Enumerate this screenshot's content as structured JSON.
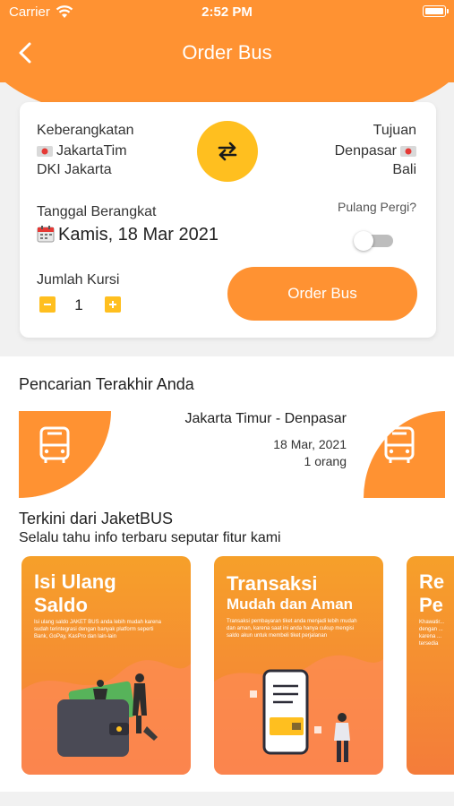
{
  "status_bar": {
    "carrier": "Carrier",
    "time": "2:52 PM"
  },
  "header": {
    "title": "Order Bus",
    "back_icon": "chevron-left-icon"
  },
  "booking": {
    "departure_label": "Keberangkatan",
    "departure_city": "JakartaTim",
    "departure_province": "DKI Jakarta",
    "destination_label": "Tujuan",
    "destination_city": "Denpasar",
    "destination_province": "Bali",
    "swap_icon": "swap-arrows-icon",
    "date_label": "Tanggal Berangkat",
    "date_value": "Kamis, 18 Mar 2021",
    "round_trip_label": "Pulang Pergi?",
    "round_trip_enabled": false,
    "seats_label": "Jumlah Kursi",
    "seats_value": "1",
    "order_button": "Order Bus"
  },
  "recent": {
    "title": "Pencarian Terakhir Anda",
    "route": "Jakarta Timur - Denpasar",
    "date": "18 Mar, 2021",
    "passengers": "1 orang"
  },
  "news": {
    "title": "Terkini dari JaketBUS",
    "subtitle": "Selalu tahu info terbaru seputar fitur kami",
    "cards": [
      {
        "title_line1": "Isi Ulang",
        "title_line2": "Saldo",
        "description": "Isi ulang saldo JAKET BUS anda lebih mudah karena sudah terintegrasi dengan banyak platform seperti Bank, GoPay, KasPro dan lain-lain"
      },
      {
        "title_line1": "Transaksi",
        "title_line2": "Mudah dan Aman",
        "description": "Transaksi pembayaran tiket anda menjadi lebih mudah dan aman, karena saat ini anda hanya cukup mengisi saldo akun untuk membeli tiket perjalanan"
      },
      {
        "title_line1": "Re",
        "title_line2": "Pe",
        "description": "Khawatir... dengan ... karena ... tersedia"
      }
    ]
  },
  "colors": {
    "primary": "#ff9232",
    "accent": "#ffbf1f",
    "background": "#f1f1f1"
  }
}
